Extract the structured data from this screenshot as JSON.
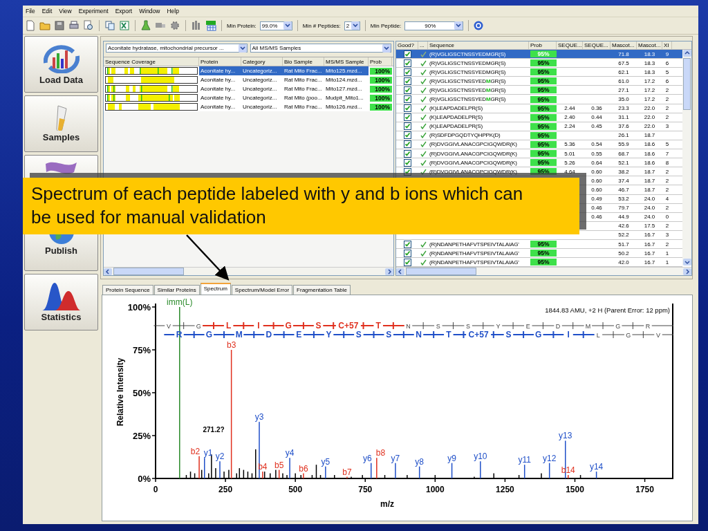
{
  "menu": [
    "File",
    "Edit",
    "View",
    "Experiment",
    "Export",
    "Window",
    "Help"
  ],
  "filters": [
    {
      "label": "Min Protein:",
      "value": "99.0%",
      "kind": "narrow"
    },
    {
      "label": "Min # Peptides:",
      "value": "2",
      "kind": "tiny"
    },
    {
      "label": "Min Peptide:",
      "value": "90%",
      "kind": "wide"
    }
  ],
  "sidebar": [
    {
      "label": "Load Data",
      "kind": "load"
    },
    {
      "label": "Samples",
      "kind": "samples"
    },
    {
      "kind": "ribbon"
    },
    {
      "label": "Publish",
      "kind": "publish"
    },
    {
      "label": "Statistics",
      "kind": "statistics"
    }
  ],
  "protein_panel": {
    "protein_select": "Aconitate hydratase, mitochondrial precursor ...",
    "sample_select": "All MS/MS Samples",
    "columns": [
      "Sequence Coverage",
      "Protein",
      "Category",
      "Bio Sample",
      "MS/MS Sample",
      "Prob"
    ],
    "rows": [
      {
        "protein": "Aconitate hy...",
        "category": "Uncategoriz...",
        "bio_sample": "Rat Mito Frac...",
        "msms_sample": "Mito125.mzd...",
        "prob": "100%",
        "selected": true
      },
      {
        "protein": "Aconitate hy...",
        "category": "Uncategoriz...",
        "bio_sample": "Rat Mito Frac...",
        "msms_sample": "Mito124.mzd...",
        "prob": "100%",
        "selected": false
      },
      {
        "protein": "Aconitate hy...",
        "category": "Uncategoriz...",
        "bio_sample": "Rat Mito Frac...",
        "msms_sample": "Mito127.mzd...",
        "prob": "100%",
        "selected": false
      },
      {
        "protein": "Aconitate hy...",
        "category": "Uncategoriz...",
        "bio_sample": "Rat Mito (poo...",
        "msms_sample": "Mudpit_Mito1...",
        "prob": "100%",
        "selected": false
      },
      {
        "protein": "Aconitate hy...",
        "category": "Uncategoriz...",
        "bio_sample": "Rat Mito Frac...",
        "msms_sample": "Mito126.mzd...",
        "prob": "100%",
        "selected": false
      }
    ]
  },
  "peptide_panel": {
    "columns": [
      "Good?",
      "...",
      "Sequence",
      "Prob",
      "SEQUE...",
      "SEQUE...",
      "Mascot...",
      "Mascot...",
      "XI"
    ],
    "rows": [
      {
        "good": true,
        "sequence": "(R)VGLIGSCTNSSYEDMGR(S)",
        "prob": "95%",
        "mascot_1": "71.8",
        "mascot_2": "18.3",
        "xi": "9",
        "selected": true
      },
      {
        "good": true,
        "sequence": "(R)VGLIGSCTNSSYEDMGR(S)",
        "prob": "95%",
        "mascot_1": "67.5",
        "mascot_2": "18.3",
        "xi": "6",
        "selected": false
      },
      {
        "good": true,
        "sequence": "(R)VGLIGSCTNSSYEDMGR(S)",
        "prob": "95%",
        "mascot_1": "62.1",
        "mascot_2": "18.3",
        "xi": "5",
        "selected": false
      },
      {
        "good": true,
        "sequence": "(R)VGLIGSCTNSSYED**M**GR(S)",
        "prob": "95%",
        "mascot_1": "61.0",
        "mascot_2": "17.2",
        "xi": "6",
        "selected": false
      },
      {
        "good": true,
        "sequence": "(R)VGLIGSCTNSSYED**M**GR(S)",
        "prob": "95%",
        "mascot_1": "27.1",
        "mascot_2": "17.2",
        "xi": "2",
        "selected": false
      },
      {
        "good": true,
        "sequence": "(R)VGLIGSCTNSSYED**M**GR(S)",
        "prob": "95%",
        "mascot_1": "35.0",
        "mascot_2": "17.2",
        "xi": "2",
        "selected": false
      },
      {
        "good": true,
        "sequence": "(K)LEAPDADELPR(S)",
        "prob": "95%",
        "seque_1": "2.44",
        "seque_2": "0.36",
        "mascot_1": "23.3",
        "mascot_2": "22.0",
        "xi": "2",
        "selected": false
      },
      {
        "good": true,
        "sequence": "(K)LEAPDADELPR(S)",
        "prob": "95%",
        "seque_1": "2.40",
        "seque_2": "0.44",
        "mascot_1": "31.1",
        "mascot_2": "22.0",
        "xi": "2",
        "selected": false
      },
      {
        "good": true,
        "sequence": "(K)LEAPDADELPR(S)",
        "prob": "95%",
        "seque_1": "2.24",
        "seque_2": "0.45",
        "mascot_1": "37.6",
        "mascot_2": "22.0",
        "xi": "3",
        "selected": false
      },
      {
        "good": true,
        "sequence": "(R)SDFDPGQDTYQHPPK(D)",
        "prob": "95%",
        "mascot_1": "26.1",
        "mascot_2": "18.7",
        "selected": false
      },
      {
        "good": true,
        "sequence": "(R)DVGGIVLANACGPCIGQWDR(K)",
        "prob": "95%",
        "seque_1": "5.36",
        "seque_2": "0.54",
        "mascot_1": "55.9",
        "mascot_2": "18.6",
        "xi": "5",
        "selected": false
      },
      {
        "good": true,
        "sequence": "(R)DVGGIVLANACGPCIGQWDR(K)",
        "prob": "95%",
        "seque_1": "5.01",
        "seque_2": "0.55",
        "mascot_1": "68.7",
        "mascot_2": "18.6",
        "xi": "7",
        "selected": false
      },
      {
        "good": true,
        "sequence": "(R)DVGGIVLANACGPCIGQWDR(K)",
        "prob": "95%",
        "seque_1": "5.26",
        "seque_2": "0.64",
        "mascot_1": "52.1",
        "mascot_2": "18.6",
        "xi": "8",
        "selected": false
      },
      {
        "good": true,
        "sequence": "(R)DVGGIVLANACGPCIGQWDR(K)",
        "prob": "95%",
        "seque_1": "4.64",
        "seque_2": "0.60",
        "mascot_1": "38.2",
        "mascot_2": "18.7",
        "xi": "2",
        "selected": false
      },
      {
        "seque_2": "0.60",
        "mascot_1": "37.4",
        "mascot_2": "18.7",
        "xi": "2",
        "selected": false
      },
      {
        "seque_2": "0.60",
        "mascot_1": "46.7",
        "mascot_2": "18.7",
        "xi": "2",
        "selected": false
      },
      {
        "seque_2": "0.49",
        "mascot_1": "53.2",
        "mascot_2": "24.0",
        "xi": "4",
        "selected": false
      },
      {
        "seque_2": "0.46",
        "mascot_1": "79.7",
        "mascot_2": "24.0",
        "xi": "2",
        "selected": false
      },
      {
        "seque_2": "0.46",
        "mascot_1": "44.9",
        "mascot_2": "24.0",
        "xi": "0",
        "selected": false
      },
      {
        "mascot_1": "42.6",
        "mascot_2": "17.5",
        "xi": "2",
        "selected": false
      },
      {
        "mascot_1": "52.2",
        "mascot_2": "16.7",
        "xi": "3",
        "selected": false
      },
      {
        "good": true,
        "sequence": "(R)NDANPETHAFVTSPEIVTALAIAG'",
        "prob": "95%",
        "mascot_1": "51.7",
        "mascot_2": "16.7",
        "xi": "2",
        "selected": false
      },
      {
        "good": true,
        "sequence": "(R)NDANPETHAFVTSPEIVTALAIAG'",
        "prob": "95%",
        "mascot_1": "50.2",
        "mascot_2": "16.7",
        "xi": "1",
        "selected": false
      },
      {
        "good": true,
        "sequence": "(R)NDANPETHAFVTSPEIVTALAIAG'",
        "prob": "95%",
        "mascot_1": "42.0",
        "mascot_2": "16.7",
        "xi": "1",
        "selected": false
      }
    ]
  },
  "tabs": [
    {
      "label": "Protein Sequence",
      "selected": false
    },
    {
      "label": "Similar Proteins",
      "selected": false
    },
    {
      "label": "Spectrum",
      "selected": true
    },
    {
      "label": "Spectrum/Model Error",
      "selected": false
    },
    {
      "label": "Fragmentation Table",
      "selected": false
    }
  ],
  "spectrum": {
    "header": "1844.83 AMU, +2 H (Parent Error: 12 ppm)",
    "ladders": [
      {
        "color": "#e0301e",
        "residues": [
          {
            "text": "V",
            "matched": false
          },
          {
            "text": "G",
            "matched": false
          },
          {
            "text": "L",
            "matched": true
          },
          {
            "text": "I",
            "matched": true
          },
          {
            "text": "G",
            "matched": true
          },
          {
            "text": "S",
            "matched": true
          },
          {
            "text": "C+57",
            "matched": true
          },
          {
            "text": "T",
            "matched": true
          },
          {
            "text": "N",
            "matched": false
          },
          {
            "text": "S",
            "matched": false
          },
          {
            "text": "S",
            "matched": false
          },
          {
            "text": "Y",
            "matched": false
          },
          {
            "text": "E",
            "matched": false
          },
          {
            "text": "D",
            "matched": false
          },
          {
            "text": "M",
            "matched": false
          },
          {
            "text": "G",
            "matched": false
          },
          {
            "text": "R",
            "matched": false
          }
        ]
      },
      {
        "color": "#1f4fc8",
        "residues": [
          {
            "text": "R",
            "matched": true
          },
          {
            "text": "G",
            "matched": true
          },
          {
            "text": "M",
            "matched": true
          },
          {
            "text": "D",
            "matched": true
          },
          {
            "text": "E",
            "matched": true
          },
          {
            "text": "Y",
            "matched": true
          },
          {
            "text": "S",
            "matched": true
          },
          {
            "text": "S",
            "matched": true
          },
          {
            "text": "N",
            "matched": true
          },
          {
            "text": "T",
            "matched": true
          },
          {
            "text": "C+57",
            "matched": true
          },
          {
            "text": "S",
            "matched": true
          },
          {
            "text": "G",
            "matched": true
          },
          {
            "text": "I",
            "matched": true
          },
          {
            "text": "L",
            "matched": false
          },
          {
            "text": "G",
            "matched": false
          },
          {
            "text": "V",
            "matched": false
          }
        ]
      }
    ],
    "chart_data": {
      "type": "bar",
      "xlabel": "m/z",
      "ylabel": "Relative Intensity",
      "xlim": [
        0,
        1850
      ],
      "ylim": [
        0,
        100
      ],
      "xticks": [
        0,
        250,
        500,
        750,
        1000,
        1250,
        1500,
        1750
      ],
      "yticks": [
        {
          "value": 0,
          "label": "0%"
        },
        {
          "value": 25,
          "label": "25%"
        },
        {
          "value": 50,
          "label": "50%"
        },
        {
          "value": 75,
          "label": "75%"
        },
        {
          "value": 100,
          "label": "100%"
        }
      ],
      "series": [
        {
          "color": "#000000",
          "x": [
            110,
            125,
            140,
            165,
            190,
            200,
            215,
            245,
            262,
            290,
            300,
            315,
            330,
            345,
            358,
            390,
            410,
            430,
            455,
            470,
            500,
            520,
            560,
            575,
            590,
            640,
            700,
            740,
            820,
            900,
            1000,
            1140,
            1210,
            1300,
            1380,
            1520
          ],
          "values": [
            2,
            4,
            3,
            5,
            3,
            14,
            6,
            4,
            5,
            3,
            6,
            5,
            4,
            3,
            17,
            4,
            3,
            5,
            3,
            2,
            3,
            2,
            2,
            8,
            2,
            2,
            1,
            2,
            2,
            2,
            2,
            1,
            3,
            2,
            3,
            2
          ]
        },
        {
          "color": "#2a8a2a",
          "x": [
            86
          ],
          "values": [
            100
          ]
        },
        {
          "color": "#e0301e",
          "x": [
            156,
            271.2,
            383,
            442,
            529,
            685,
            791,
            1476
          ],
          "values": [
            13,
            75,
            4,
            5,
            3,
            1,
            12,
            2
          ]
        },
        {
          "color": "#1f4fc8",
          "x": [
            175,
            230,
            371,
            480,
            608,
            771,
            858,
            944,
            1060,
            1162,
            1320,
            1409,
            1466,
            1577
          ],
          "values": [
            12,
            10,
            33,
            12,
            7,
            9,
            9,
            7,
            9,
            10,
            8,
            9,
            22,
            4
          ]
        }
      ],
      "annotations": [
        {
          "x": 86,
          "y": 100,
          "text": "imm(L)"
        },
        {
          "x": 156,
          "y": 13,
          "text": "b2"
        },
        {
          "x": 175,
          "y": 12,
          "text": "y1"
        },
        {
          "x": 230,
          "y": 10,
          "text": "y2"
        },
        {
          "x": 271.2,
          "y": 75,
          "text": "b3"
        },
        {
          "x": 271.2,
          "y": 27,
          "text": "271.2?"
        },
        {
          "x": 371,
          "y": 33,
          "text": "y3"
        },
        {
          "x": 383,
          "y": 4,
          "text": "b4"
        },
        {
          "x": 442,
          "y": 5,
          "text": "b5"
        },
        {
          "x": 480,
          "y": 12,
          "text": "y4"
        },
        {
          "x": 529,
          "y": 3,
          "text": "b6"
        },
        {
          "x": 608,
          "y": 7,
          "text": "y5"
        },
        {
          "x": 685,
          "y": 1,
          "text": "b7"
        },
        {
          "x": 771,
          "y": 9,
          "text": "y6"
        },
        {
          "x": 791,
          "y": 12,
          "text": "b8"
        },
        {
          "x": 858,
          "y": 9,
          "text": "y7"
        },
        {
          "x": 944,
          "y": 7,
          "text": "y8"
        },
        {
          "x": 1060,
          "y": 9,
          "text": "y9"
        },
        {
          "x": 1162,
          "y": 10,
          "text": "y10"
        },
        {
          "x": 1320,
          "y": 8,
          "text": "y11"
        },
        {
          "x": 1409,
          "y": 9,
          "text": "y12"
        },
        {
          "x": 1466,
          "y": 22,
          "text": "y13"
        },
        {
          "x": 1476,
          "y": 2,
          "text": "b14"
        },
        {
          "x": 1577,
          "y": 4,
          "text": "y14"
        }
      ]
    }
  },
  "callout": {
    "text": "Spectrum of each peptide labeled with y and b ions which can be used for manual validation"
  }
}
